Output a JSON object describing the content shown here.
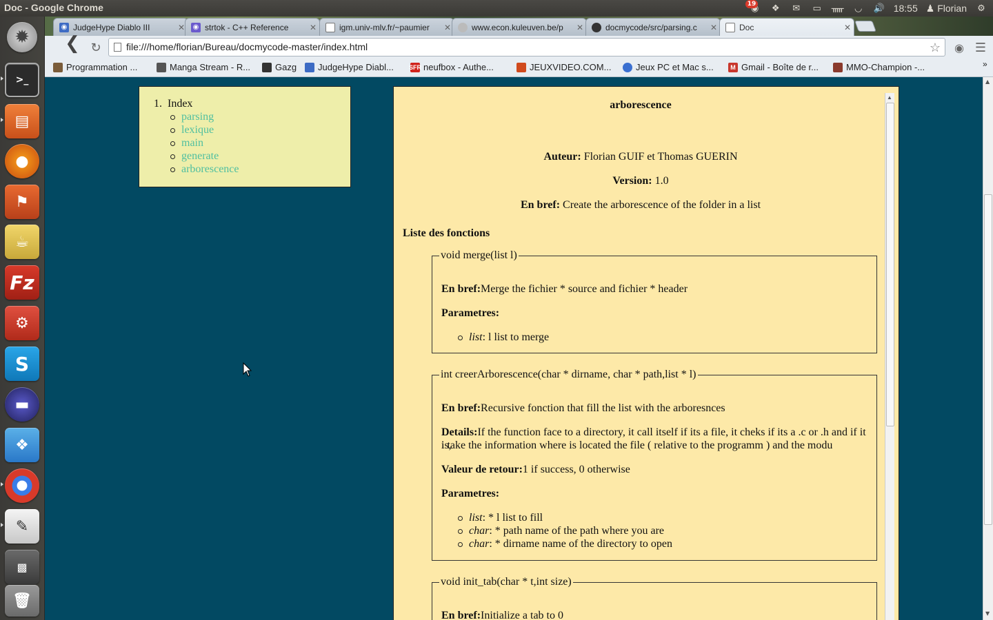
{
  "window_title": "Doc - Google Chrome",
  "panel": {
    "notification_count": "19",
    "clock": "18:55",
    "user": "Florian"
  },
  "tabs": [
    {
      "label": "JudgeHype Diablo III",
      "color": "#3d6bc4"
    },
    {
      "label": "strtok - C++ Reference",
      "color": "#6a5acd"
    },
    {
      "label": "igm.univ-mlv.fr/~paumier",
      "color": "#888888"
    },
    {
      "label": "www.econ.kuleuven.be/p",
      "color": "#888888"
    },
    {
      "label": "docmycode/src/parsing.c",
      "color": "#333333"
    },
    {
      "label": "Doc",
      "color": "#888888"
    }
  ],
  "address_bar": {
    "url": "file:///home/florian/Bureau/docmycode-master/index.html"
  },
  "bookmarks": [
    {
      "label": "Programmation ...",
      "color": "#7a5c3a"
    },
    {
      "label": "Manga Stream - R...",
      "color": "#555555"
    },
    {
      "label": "Gazg",
      "color": "#333333"
    },
    {
      "label": "JudgeHype Diabl...",
      "color": "#3d6bc4"
    },
    {
      "label": "neufbox - Authe...",
      "color": "#d0241d"
    },
    {
      "label": "JEUXVIDEO.COM...",
      "color": "#d04a1d"
    },
    {
      "label": "Jeux PC et Mac s...",
      "color": "#3a6fd0"
    },
    {
      "label": "Gmail - Boîte de r...",
      "color": "#c8372d"
    },
    {
      "label": "MMO-Champion -...",
      "color": "#8a3a2d"
    }
  ],
  "nav": {
    "index_number": "1.",
    "index_title": "Index",
    "links": [
      "parsing",
      "lexique",
      "main",
      "generate",
      "arborescence"
    ]
  },
  "doc": {
    "title": "arborescence",
    "author_label": "Auteur:",
    "author": "Florian GUIF et Thomas GUERIN",
    "version_label": "Version:",
    "version": "1.0",
    "brief_label": "En bref:",
    "brief": "Create the arborescence of the folder in a list",
    "functions_heading": "Liste des fonctions",
    "functions": [
      {
        "signature": "void merge(list l)",
        "brief_label": "En bref:",
        "brief": "Merge the fichier * source and fichier * header",
        "params_label": "Parametres:",
        "params": [
          {
            "name": "list",
            "desc": ": l list to merge"
          }
        ]
      },
      {
        "signature": "int creerArborescence(char * dirname, char * path,list * l)",
        "brief_label": "En bref:",
        "brief": "Recursive fonction that fill the list with the arboresnces",
        "details_label": "Details:",
        "details_1": "If the function face to a directory, it call itself if its a file, it cheks if its a .c or .h and if it is,",
        "details_2": "i take the information where is located the file ( relative to the programm ) and the modu",
        "return_label": "Valeur de retour:",
        "return": "1 if success, 0 otherwise",
        "params_label": "Parametres:",
        "params": [
          {
            "name": "list",
            "desc": ": * l list to fill"
          },
          {
            "name": "char",
            "desc": ": * path name of the path where you are"
          },
          {
            "name": "char",
            "desc": ": * dirname name of the directory to open"
          }
        ]
      },
      {
        "signature": "void init_tab(char * t,int size)",
        "brief_label": "En bref:",
        "brief": "Initialize a tab to 0"
      }
    ]
  }
}
